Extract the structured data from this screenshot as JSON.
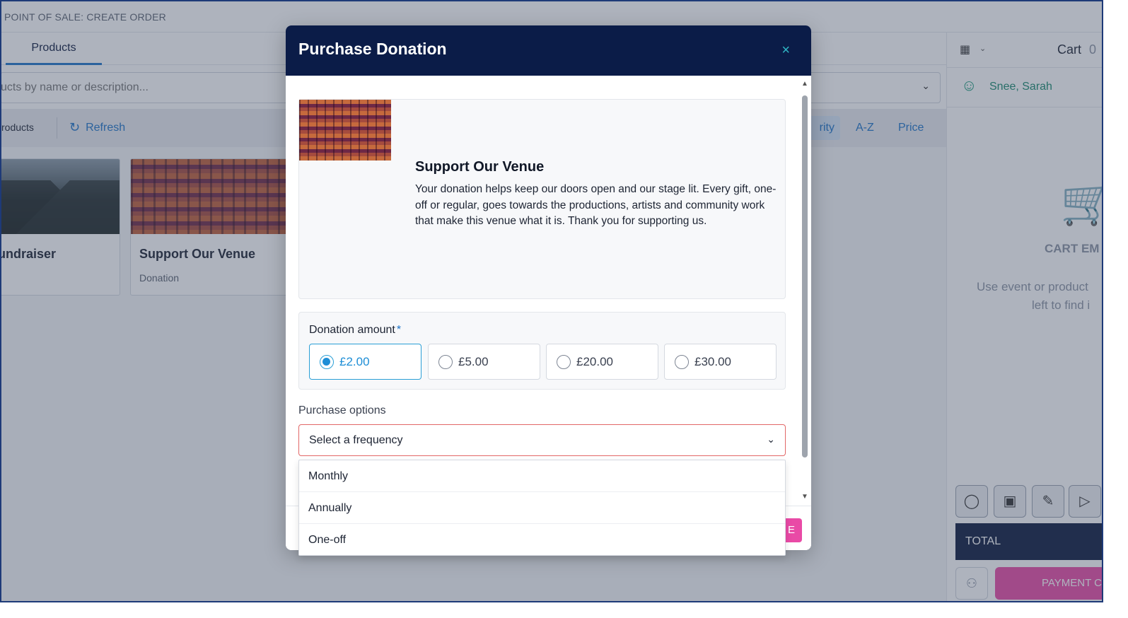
{
  "page": {
    "header_title": "POINT OF SALE: CREATE ORDER"
  },
  "tabs": {
    "products": "Products"
  },
  "search": {
    "placeholder": "ucts by name or description..."
  },
  "toolbar": {
    "products_label": "roducts",
    "refresh_label": "Refresh",
    "sort_priority": "rity",
    "sort_az": "A-Z",
    "sort_price": "Price"
  },
  "products": [
    {
      "title": "undraiser",
      "subtitle": ""
    },
    {
      "title": "Support Our Venue",
      "subtitle": "Donation"
    }
  ],
  "cart": {
    "title": "Cart",
    "count_partial": "0",
    "customer": "Snee, Sarah",
    "empty_title": "CART EM",
    "empty_hint_1": "Use event or product",
    "empty_hint_2": "left to find i",
    "total_label": "TOTAL",
    "payment_label": "PAYMENT C"
  },
  "modal": {
    "title": "Purchase Donation",
    "close_icon": "×",
    "item_title": "Support Our Venue",
    "item_description": "Your donation helps keep our doors open and our stage lit. Every gift, one-off or regular, goes towards the productions, artists and community work that make this venue what it is. Thank you for supporting us.",
    "amount_label": "Donation amount",
    "amount_required": "*",
    "amounts": [
      {
        "label": "£2.00",
        "selected": true
      },
      {
        "label": "£5.00",
        "selected": false
      },
      {
        "label": "£20.00",
        "selected": false
      },
      {
        "label": "£30.00",
        "selected": false
      }
    ],
    "purchase_options_label": "Purchase options",
    "frequency_value": "Select a frequency",
    "footer_button_partial": "E"
  },
  "dropdown": {
    "options": [
      "Monthly",
      "Annually",
      "One-off"
    ]
  },
  "colors": {
    "header_navy": "#0b1c48",
    "accent_blue": "#1e74c8",
    "selected_radio": "#1e8ed6",
    "error_border": "#e26767",
    "primary_pink": "#e94aa6",
    "customer_green": "#1a8a6e"
  }
}
